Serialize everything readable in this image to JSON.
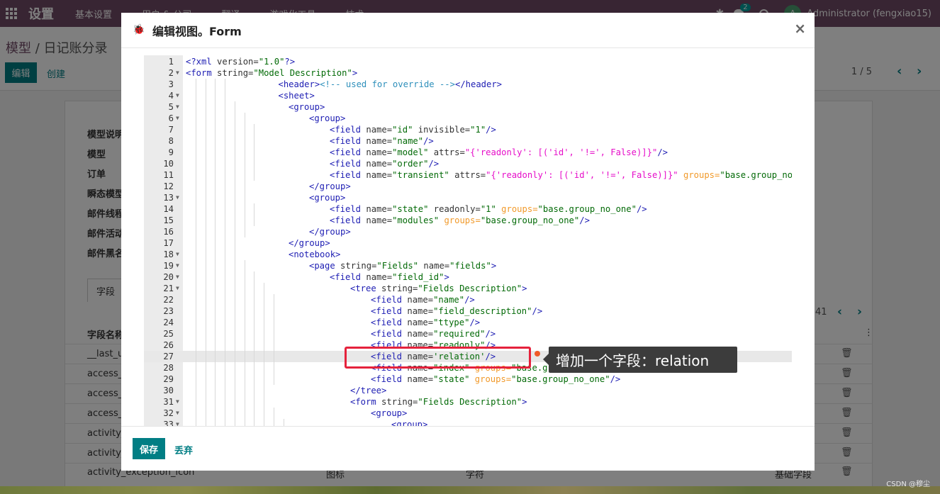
{
  "topbar": {
    "brand": "设置",
    "menu": [
      "基本设置",
      "用户 & 公司",
      "翻译",
      "游戏化工具",
      "技术"
    ],
    "chat_badge": "2",
    "avatar_letter": "A",
    "user": "Administrator (fengxiao15)"
  },
  "control": {
    "breadcrumb_parent": "模型",
    "breadcrumb_sep": " / ",
    "breadcrumb_current": "日记账分录",
    "edit_label": "编辑",
    "create_label": "创建",
    "pager": "1 / 5"
  },
  "form": {
    "labels": [
      "模型说明",
      "模型",
      "订单",
      "瞬态模型",
      "邮件线程",
      "邮件活动",
      "邮件黑名"
    ],
    "tab_fields": "字段",
    "column_field_name": "字段名称",
    "sub_count": "41",
    "rows": [
      "__last_up",
      "access_r",
      "access_r",
      "access_s",
      "activity_",
      "activity_",
      "activity_exception_icon"
    ],
    "last_row": {
      "desc": "图标",
      "type": "字符",
      "kind": "基础字段"
    }
  },
  "modal": {
    "title": "编辑视图。Form",
    "save_label": "保存",
    "discard_label": "丢弃",
    "code_lines": [
      {
        "n": "1",
        "fold": false,
        "lvl": 0,
        "tokens": [
          [
            "tag",
            "<?xml"
          ],
          [
            "attr",
            " version="
          ],
          [
            "str",
            "\"1.0\""
          ],
          [
            "tag",
            "?>"
          ]
        ]
      },
      {
        "n": "2",
        "fold": true,
        "lvl": 0,
        "tokens": [
          [
            "tag",
            "<form"
          ],
          [
            "attr",
            " string="
          ],
          [
            "str",
            "\"Model Description\""
          ],
          [
            "tag",
            ">"
          ]
        ]
      },
      {
        "n": "3",
        "fold": false,
        "lvl": 9,
        "tokens": [
          [
            "tag",
            "<header>"
          ],
          [
            "com",
            "<!-- used for override -->"
          ],
          [
            "tag",
            "</header>"
          ]
        ]
      },
      {
        "n": "4",
        "fold": true,
        "lvl": 9,
        "tokens": [
          [
            "tag",
            "<sheet>"
          ]
        ]
      },
      {
        "n": "5",
        "fold": true,
        "lvl": 10,
        "tokens": [
          [
            "tag",
            "<group>"
          ]
        ]
      },
      {
        "n": "6",
        "fold": true,
        "lvl": 12,
        "tokens": [
          [
            "tag",
            "<group>"
          ]
        ]
      },
      {
        "n": "7",
        "fold": false,
        "lvl": 14,
        "tokens": [
          [
            "tag",
            "<field"
          ],
          [
            "attr",
            " name="
          ],
          [
            "str",
            "\"id\""
          ],
          [
            "attr",
            " invisible="
          ],
          [
            "str",
            "\"1\""
          ],
          [
            "tag",
            "/>"
          ]
        ]
      },
      {
        "n": "8",
        "fold": false,
        "lvl": 14,
        "tokens": [
          [
            "tag",
            "<field"
          ],
          [
            "attr",
            " name="
          ],
          [
            "str",
            "\"name\""
          ],
          [
            "tag",
            "/>"
          ]
        ]
      },
      {
        "n": "9",
        "fold": false,
        "lvl": 14,
        "tokens": [
          [
            "tag",
            "<field"
          ],
          [
            "attr",
            " name="
          ],
          [
            "str",
            "\"model\""
          ],
          [
            "attr",
            " attrs="
          ],
          [
            "mag",
            "\"{'readonly': [('id', '!=', False)]}\""
          ],
          [
            "tag",
            "/>"
          ]
        ]
      },
      {
        "n": "10",
        "fold": false,
        "lvl": 14,
        "tokens": [
          [
            "tag",
            "<field"
          ],
          [
            "attr",
            " name="
          ],
          [
            "str",
            "\"order\""
          ],
          [
            "tag",
            "/>"
          ]
        ]
      },
      {
        "n": "11",
        "fold": false,
        "lvl": 14,
        "tokens": [
          [
            "tag",
            "<field"
          ],
          [
            "attr",
            " name="
          ],
          [
            "str",
            "\"transient\""
          ],
          [
            "attr",
            " attrs="
          ],
          [
            "mag",
            "\"{'readonly': [('id', '!=', False)]}\""
          ],
          [
            "grp",
            " groups="
          ],
          [
            "str",
            "\"base.group_no_one\"/>"
          ]
        ]
      },
      {
        "n": "12",
        "fold": false,
        "lvl": 12,
        "tokens": [
          [
            "tag",
            "</group>"
          ]
        ]
      },
      {
        "n": "13",
        "fold": true,
        "lvl": 12,
        "tokens": [
          [
            "tag",
            "<group>"
          ]
        ]
      },
      {
        "n": "14",
        "fold": false,
        "lvl": 14,
        "tokens": [
          [
            "tag",
            "<field"
          ],
          [
            "attr",
            " name="
          ],
          [
            "str",
            "\"state\""
          ],
          [
            "attr",
            " readonly="
          ],
          [
            "str",
            "\"1\""
          ],
          [
            "grp",
            " groups="
          ],
          [
            "str",
            "\"base.group_no_one\""
          ],
          [
            "tag",
            "/>"
          ]
        ]
      },
      {
        "n": "15",
        "fold": false,
        "lvl": 14,
        "tokens": [
          [
            "tag",
            "<field"
          ],
          [
            "attr",
            " name="
          ],
          [
            "str",
            "\"modules\""
          ],
          [
            "grp",
            " groups="
          ],
          [
            "str",
            "\"base.group_no_one\""
          ],
          [
            "tag",
            "/>"
          ]
        ]
      },
      {
        "n": "16",
        "fold": false,
        "lvl": 12,
        "tokens": [
          [
            "tag",
            "</group>"
          ]
        ]
      },
      {
        "n": "17",
        "fold": false,
        "lvl": 10,
        "tokens": [
          [
            "tag",
            "</group>"
          ]
        ]
      },
      {
        "n": "18",
        "fold": true,
        "lvl": 10,
        "tokens": [
          [
            "tag",
            "<notebook>"
          ]
        ]
      },
      {
        "n": "19",
        "fold": true,
        "lvl": 12,
        "tokens": [
          [
            "tag",
            "<page"
          ],
          [
            "attr",
            " string="
          ],
          [
            "str",
            "\"Fields\""
          ],
          [
            "attr",
            " name="
          ],
          [
            "str",
            "\"fields\""
          ],
          [
            "tag",
            ">"
          ]
        ]
      },
      {
        "n": "20",
        "fold": true,
        "lvl": 14,
        "tokens": [
          [
            "tag",
            "<field"
          ],
          [
            "attr",
            " name="
          ],
          [
            "str",
            "\"field_id\""
          ],
          [
            "tag",
            ">"
          ]
        ]
      },
      {
        "n": "21",
        "fold": true,
        "lvl": 16,
        "tokens": [
          [
            "tag",
            "<tree"
          ],
          [
            "attr",
            " string="
          ],
          [
            "str",
            "\"Fields Description\""
          ],
          [
            "tag",
            ">"
          ]
        ]
      },
      {
        "n": "22",
        "fold": false,
        "lvl": 18,
        "tokens": [
          [
            "tag",
            "<field"
          ],
          [
            "attr",
            " name="
          ],
          [
            "str",
            "\"name\""
          ],
          [
            "tag",
            "/>"
          ]
        ]
      },
      {
        "n": "23",
        "fold": false,
        "lvl": 18,
        "tokens": [
          [
            "tag",
            "<field"
          ],
          [
            "attr",
            " name="
          ],
          [
            "str",
            "\"field_description\""
          ],
          [
            "tag",
            "/>"
          ]
        ]
      },
      {
        "n": "24",
        "fold": false,
        "lvl": 18,
        "tokens": [
          [
            "tag",
            "<field"
          ],
          [
            "attr",
            " name="
          ],
          [
            "str",
            "\"ttype\""
          ],
          [
            "tag",
            "/>"
          ]
        ]
      },
      {
        "n": "25",
        "fold": false,
        "lvl": 18,
        "tokens": [
          [
            "tag",
            "<field"
          ],
          [
            "attr",
            " name="
          ],
          [
            "str",
            "\"required\""
          ],
          [
            "tag",
            "/>"
          ]
        ]
      },
      {
        "n": "26",
        "fold": false,
        "lvl": 18,
        "tokens": [
          [
            "tag",
            "<field"
          ],
          [
            "attr",
            " name="
          ],
          [
            "str",
            "\"readonly\""
          ],
          [
            "tag",
            "/>"
          ]
        ]
      },
      {
        "n": "27",
        "fold": false,
        "lvl": 18,
        "active": true,
        "tokens": [
          [
            "tag",
            "<field"
          ],
          [
            "attr",
            " name="
          ],
          [
            "str",
            "'relation'"
          ],
          [
            "tag",
            "/>"
          ]
        ]
      },
      {
        "n": "28",
        "fold": false,
        "lvl": 18,
        "tokens": [
          [
            "tag",
            "<field"
          ],
          [
            "attr",
            " name="
          ],
          [
            "str",
            "\"index\""
          ],
          [
            "grp",
            " groups="
          ],
          [
            "str",
            "\"base.group_no_one\""
          ],
          [
            "tag",
            "/>"
          ]
        ]
      },
      {
        "n": "29",
        "fold": false,
        "lvl": 18,
        "tokens": [
          [
            "tag",
            "<field"
          ],
          [
            "attr",
            " name="
          ],
          [
            "str",
            "\"state\""
          ],
          [
            "grp",
            " groups="
          ],
          [
            "str",
            "\"base.group_no_one\""
          ],
          [
            "tag",
            "/>"
          ]
        ]
      },
      {
        "n": "30",
        "fold": false,
        "lvl": 16,
        "tokens": [
          [
            "tag",
            "</tree>"
          ]
        ]
      },
      {
        "n": "31",
        "fold": true,
        "lvl": 16,
        "tokens": [
          [
            "tag",
            "<form"
          ],
          [
            "attr",
            " string="
          ],
          [
            "str",
            "\"Fields Description\""
          ],
          [
            "tag",
            ">"
          ]
        ]
      },
      {
        "n": "32",
        "fold": true,
        "lvl": 18,
        "tokens": [
          [
            "tag",
            "<group>"
          ]
        ]
      },
      {
        "n": "33",
        "fold": true,
        "lvl": 20,
        "tokens": [
          [
            "tag",
            "<group>"
          ]
        ]
      }
    ]
  },
  "annotation": {
    "text": "增加一个字段：relation",
    "box_color": "#e5223c"
  },
  "watermark": "CSDN @穆尘",
  "colors": {
    "brand": "#714b67",
    "primary": "#017e84"
  }
}
